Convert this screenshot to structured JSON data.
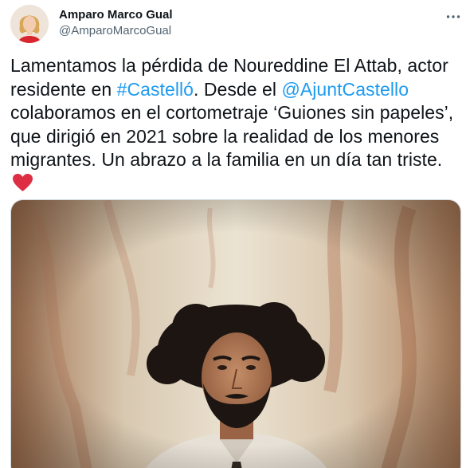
{
  "author": {
    "name": "Amparo Marco Gual",
    "handle": "@AmparoMarcoGual"
  },
  "tweet": {
    "text_1": "Lamentamos la pérdida de Noureddine El Attab, actor residente en ",
    "hashtag": "#Castelló",
    "text_2": ". Desde el ",
    "mention": "@AjuntCastello",
    "text_3": " colaboramos en el cortometraje ‘Guiones sin papeles’, que dirigió en 2021 sobre la realidad de los menores migrantes. Un abrazo a la familia en un día tan triste. "
  },
  "icons": {
    "more": "more-dots-icon",
    "emoji": "red-heart-icon"
  },
  "colors": {
    "link": "#1d9bf0",
    "text": "#0f1419",
    "secondary": "#536471",
    "heart": "#e0245e"
  }
}
